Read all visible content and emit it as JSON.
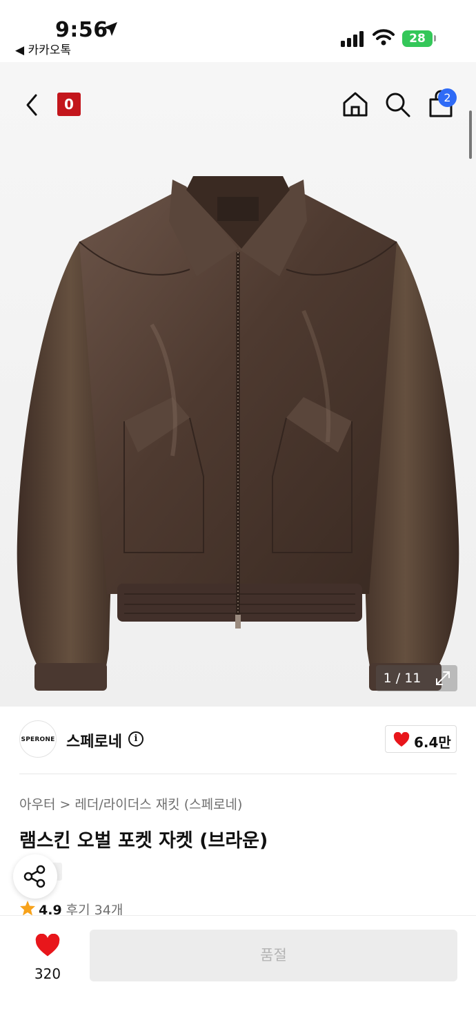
{
  "status_bar": {
    "time": "9:56",
    "back_app": "◀ 카카오톡",
    "battery": "28"
  },
  "header": {
    "brand_logo": "0",
    "cart_count": "2"
  },
  "gallery": {
    "counter": "1 / 11"
  },
  "brand": {
    "avatar_text": "SPERONE",
    "name": "스페로네",
    "likes": "6.4만"
  },
  "product": {
    "breadcrumb": [
      "아우터",
      "레더/라이더스 재킷 (스페로네)"
    ],
    "title": "램스킨 오벌 포켓 자켓 (브라운)",
    "rating": "4.9",
    "reviews": "후기 34개"
  },
  "bottom_bar": {
    "wish_count": "320",
    "buy_label": "품절"
  },
  "colors": {
    "accent_red": "#e8161b",
    "brand_red": "#c3161c",
    "badge_blue": "#2f6bf6",
    "battery_green": "#34c759"
  },
  "icons": [
    "location-arrow-icon",
    "cellular-signal-icon",
    "wifi-icon",
    "battery-icon",
    "back-chevron-icon",
    "home-icon",
    "search-icon",
    "shopping-bag-icon",
    "expand-icon",
    "info-icon",
    "heart-icon",
    "share-icon",
    "star-icon"
  ]
}
